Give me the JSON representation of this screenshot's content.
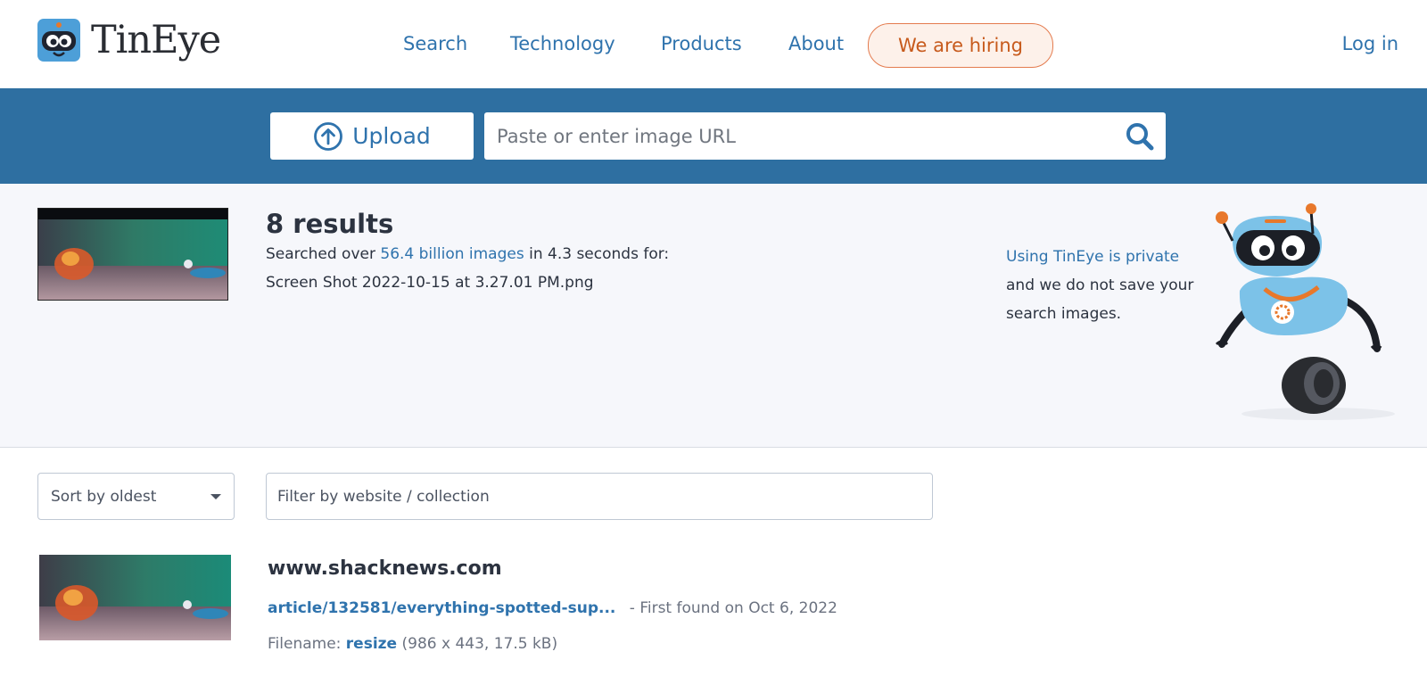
{
  "header": {
    "brand": "TinEye",
    "nav": [
      "Search",
      "Technology",
      "Products",
      "About"
    ],
    "hiring": "We are hiring",
    "login": "Log in"
  },
  "search": {
    "upload_label": "Upload",
    "url_placeholder": "Paste or enter image URL"
  },
  "summary": {
    "results_count": "8 results",
    "searched_prefix": "Searched over",
    "index_size": "56.4 billion images",
    "searched_suffix": "in 4.3 seconds for:",
    "query_filename": "Screen Shot 2022-10-15 at 3.27.01 PM.png",
    "privacy_link": "Using TinEye is private",
    "privacy_text": "and we do not save your search images."
  },
  "filters": {
    "sort_value": "Sort by oldest",
    "filter_placeholder": "Filter by website / collection"
  },
  "results": [
    {
      "domain": "www.shacknews.com",
      "path": "article/132581/everything-spotted-sup...",
      "found": "- First found on Oct 6, 2022",
      "filename_label": "Filename:",
      "filename": "resize",
      "meta": "(986 x 443, 17.5 kB)"
    }
  ],
  "colors": {
    "brand_blue": "#2e6fa1",
    "link_blue": "#2f73ad",
    "hiring_orange": "#c75a1c"
  }
}
